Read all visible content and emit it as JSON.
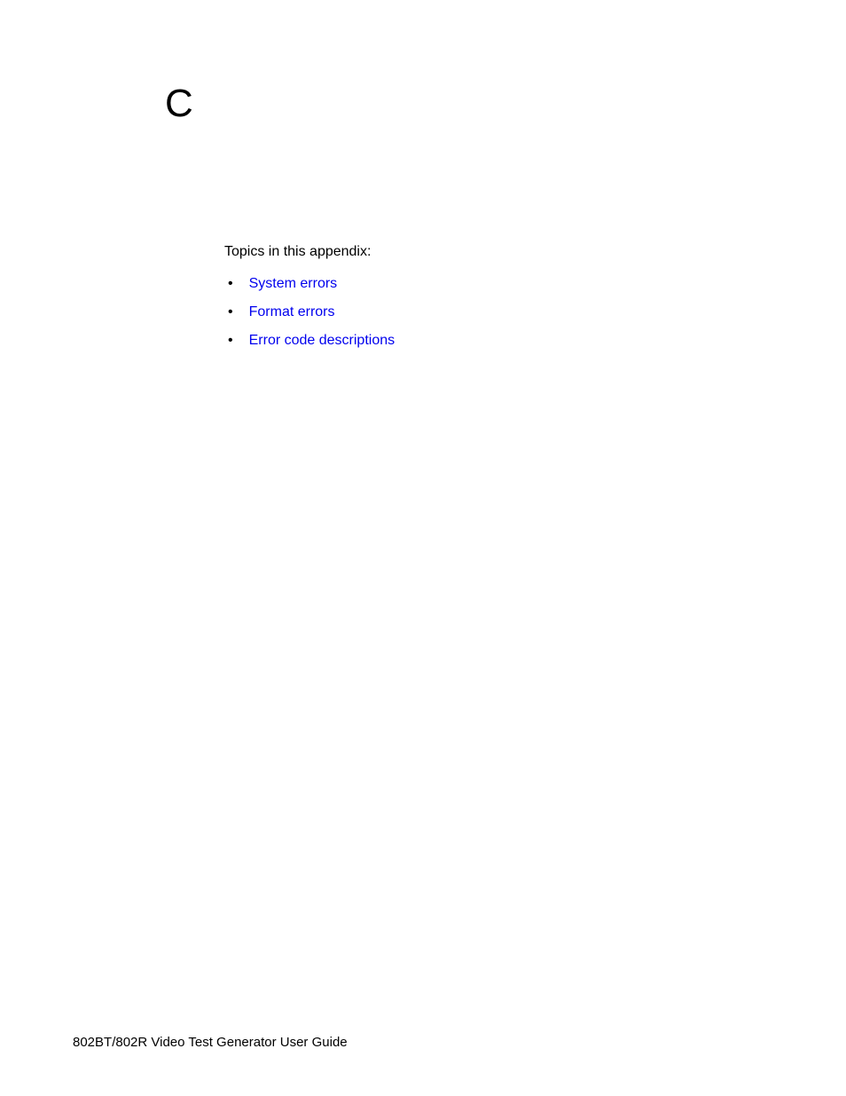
{
  "appendix_letter": "C",
  "intro_text": "Topics in this appendix:",
  "links": [
    {
      "label": "System errors"
    },
    {
      "label": "Format errors"
    },
    {
      "label": "Error code descriptions"
    }
  ],
  "footer_text": "802BT/802R Video Test Generator User Guide"
}
